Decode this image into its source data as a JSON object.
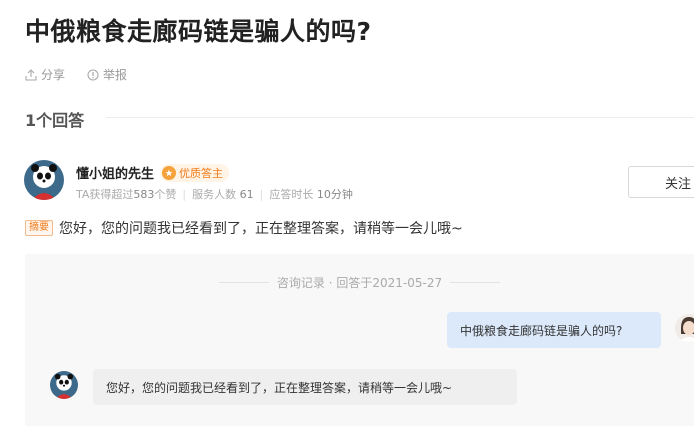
{
  "question": {
    "title": "中俄粮食走廊码链是骗人的吗?",
    "actions": {
      "share": "分享",
      "report": "举报"
    }
  },
  "answers_header": {
    "count_label": "1个回答"
  },
  "answer": {
    "author_name": "懂小姐的先生",
    "badge_label": "优质答主",
    "stats": {
      "likes_prefix": "TA获得超过",
      "likes_value": "583",
      "likes_suffix": "个赞",
      "served_label": "服务人数",
      "served_value": "61",
      "response_label": "应答时长",
      "response_value": "10分钟"
    },
    "follow_label": "关注",
    "summary_tag": "摘要",
    "summary_text": "您好，您的问题我已经看到了，正在整理答案，请稍等一会儿哦~"
  },
  "chat": {
    "meta": "咨询记录 · 回答于2021-05-27",
    "question_text": "中俄粮食走廊码链是骗人的吗?",
    "answer_text": "您好，您的问题我已经看到了，正在整理答案，请稍等一会儿哦~"
  },
  "colors": {
    "accent_orange": "#f07a18",
    "question_bubble": "#dce9fb",
    "chat_background": "#f8f8f8"
  },
  "icons": {
    "share": "share-icon",
    "report": "report-icon",
    "badge": "medal-icon",
    "avatar": "panda-avatar"
  }
}
